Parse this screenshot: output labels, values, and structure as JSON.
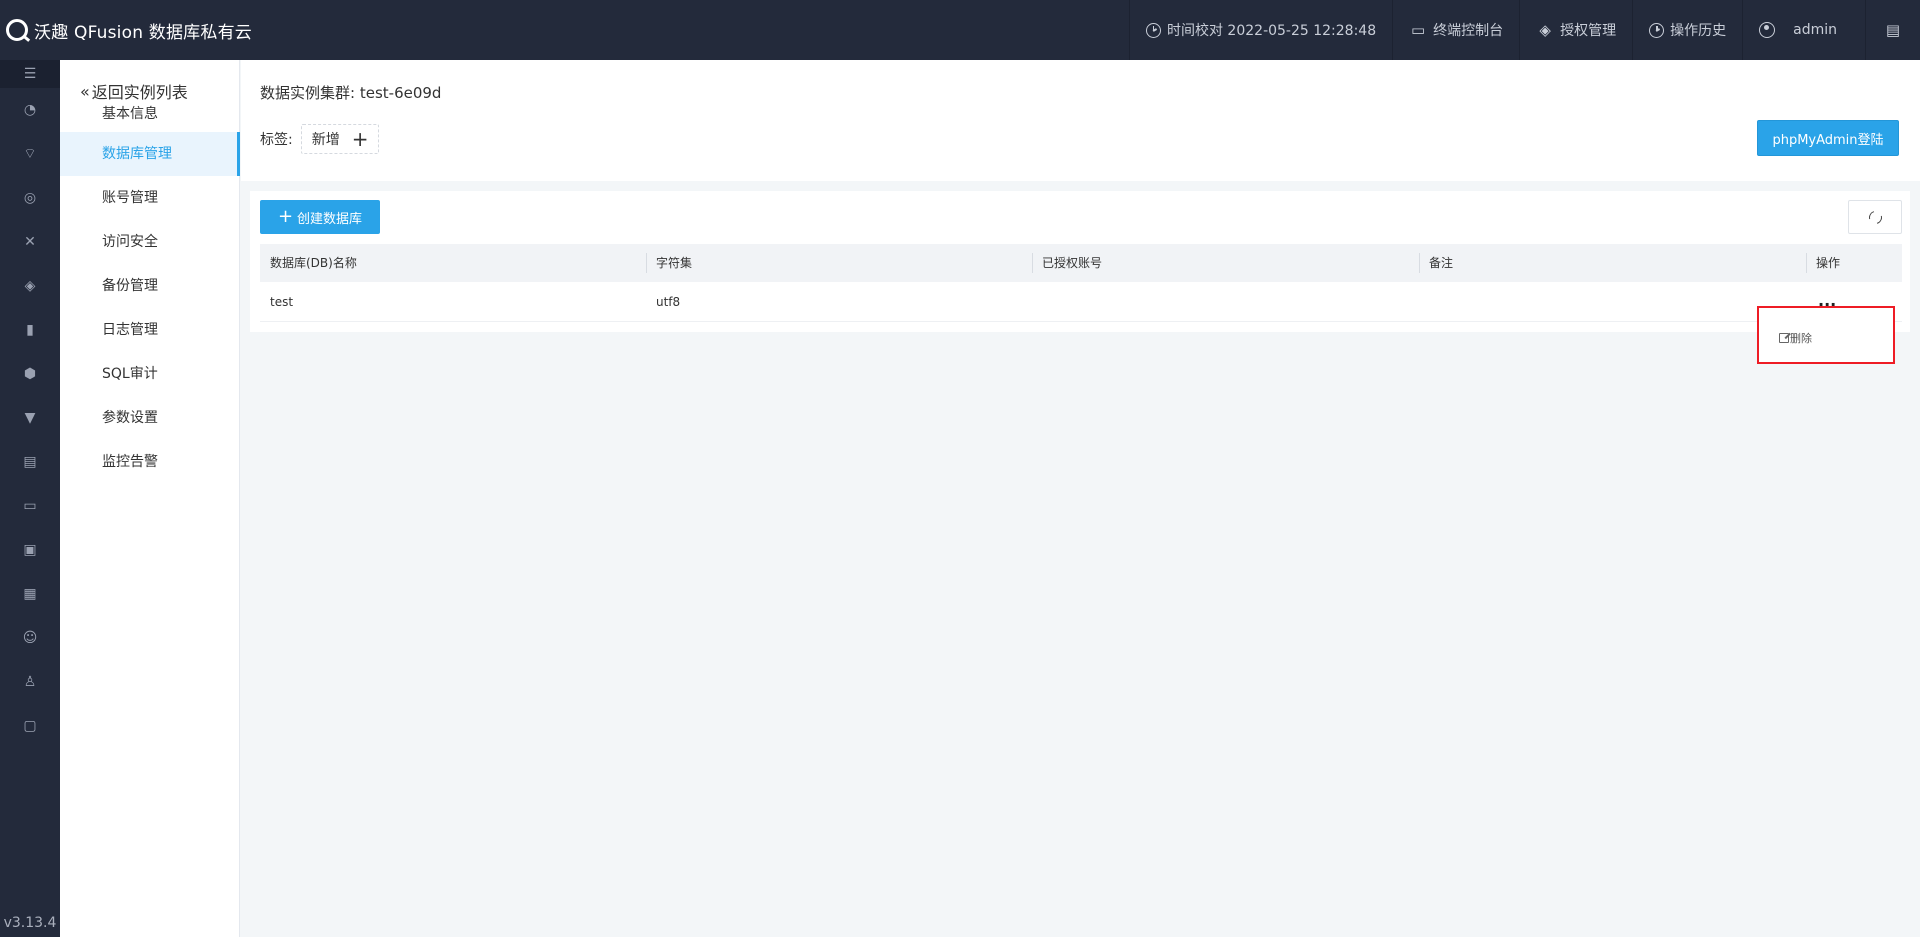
{
  "topbar": {
    "brand": "沃趣 QFusion 数据库私有云",
    "time_check": "时间校对 2022-05-25 12:28:48",
    "terminal": "终端控制台",
    "license": "授权管理",
    "history": "操作历史",
    "user": "admin",
    "icons": [
      "clock-icon",
      "monitor-icon",
      "layers-icon",
      "history-icon",
      "user-icon",
      "language-icon"
    ]
  },
  "rail": {
    "version": "v3.13.4",
    "icons": [
      "menu-icon",
      "dashboard-icon",
      "satellite-icon",
      "network-icon",
      "tools-icon",
      "layers-icon",
      "database-icon",
      "shield-icon",
      "chat-icon",
      "docs-icon",
      "monitor-icon",
      "briefcase-icon",
      "save-icon",
      "people-icon",
      "stamp-icon",
      "display-icon"
    ]
  },
  "subnav": {
    "back": "返回实例列表",
    "items": [
      "基本信息",
      "数据库管理",
      "账号管理",
      "访问安全",
      "备份管理",
      "日志管理",
      "SQL审计",
      "参数设置",
      "监控告警"
    ]
  },
  "header": {
    "cluster_label": "数据实例集群:",
    "cluster_name": "test-6e09d",
    "tags_label": "标签:",
    "tag_add": "新增",
    "phpmyadmin": "phpMyAdmin登陆"
  },
  "table": {
    "create_button": "创建数据库",
    "columns": [
      "数据库(DB)名称",
      "字符集",
      "已授权账号",
      "备注",
      "操作"
    ],
    "rows": [
      {
        "name": "test",
        "charset": "utf8",
        "accounts": "",
        "note": "",
        "action": "..."
      }
    ]
  },
  "dropdown": {
    "delete": "删除"
  }
}
